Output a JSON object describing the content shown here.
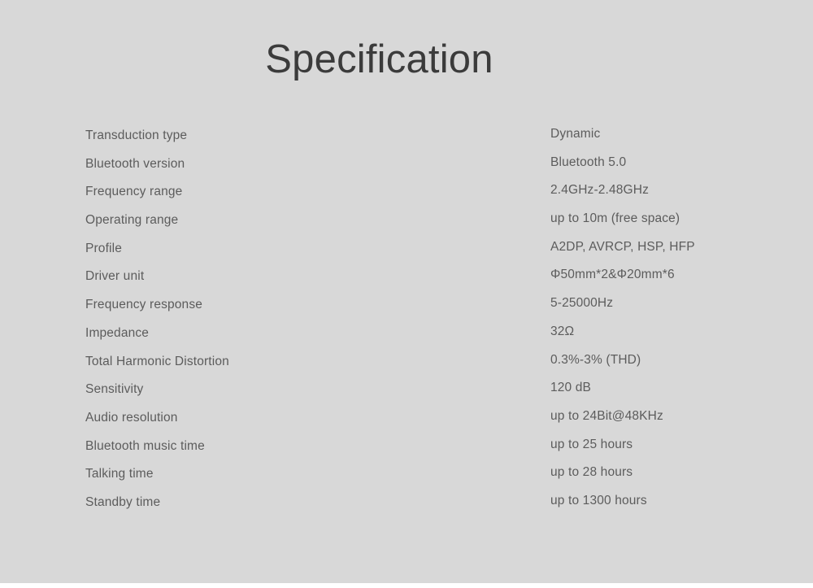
{
  "document": {
    "title": "Specification",
    "background_color": "#d8d8d8",
    "title_color": "#3b3b3b",
    "text_color": "#5c5c5c"
  },
  "spec_table": {
    "rows": [
      {
        "label": "Transduction type",
        "value": "Dynamic"
      },
      {
        "label": "Bluetooth version",
        "value": "Bluetooth 5.0"
      },
      {
        "label": "Frequency range",
        "value": "2.4GHz-2.48GHz"
      },
      {
        "label": "Operating range",
        "value": "up to 10m (free space)"
      },
      {
        "label": "Profile",
        "value": "A2DP, AVRCP, HSP, HFP"
      },
      {
        "label": "Driver unit",
        "value": "Φ50mm*2&Φ20mm*6"
      },
      {
        "label": "Frequency response",
        "value": "5-25000Hz"
      },
      {
        "label": "Impedance",
        "value": "32Ω"
      },
      {
        "label": "Total Harmonic Distortion",
        "value": "0.3%-3% (THD)"
      },
      {
        "label": "Sensitivity",
        "value": "120 dB"
      },
      {
        "label": "Audio resolution",
        "value": "up to 24Bit@48KHz"
      },
      {
        "label": "Bluetooth music time",
        "value": "up to 25 hours"
      },
      {
        "label": "Talking time",
        "value": "up to 28 hours"
      },
      {
        "label": "Standby time",
        "value": "up to 1300 hours"
      }
    ]
  }
}
